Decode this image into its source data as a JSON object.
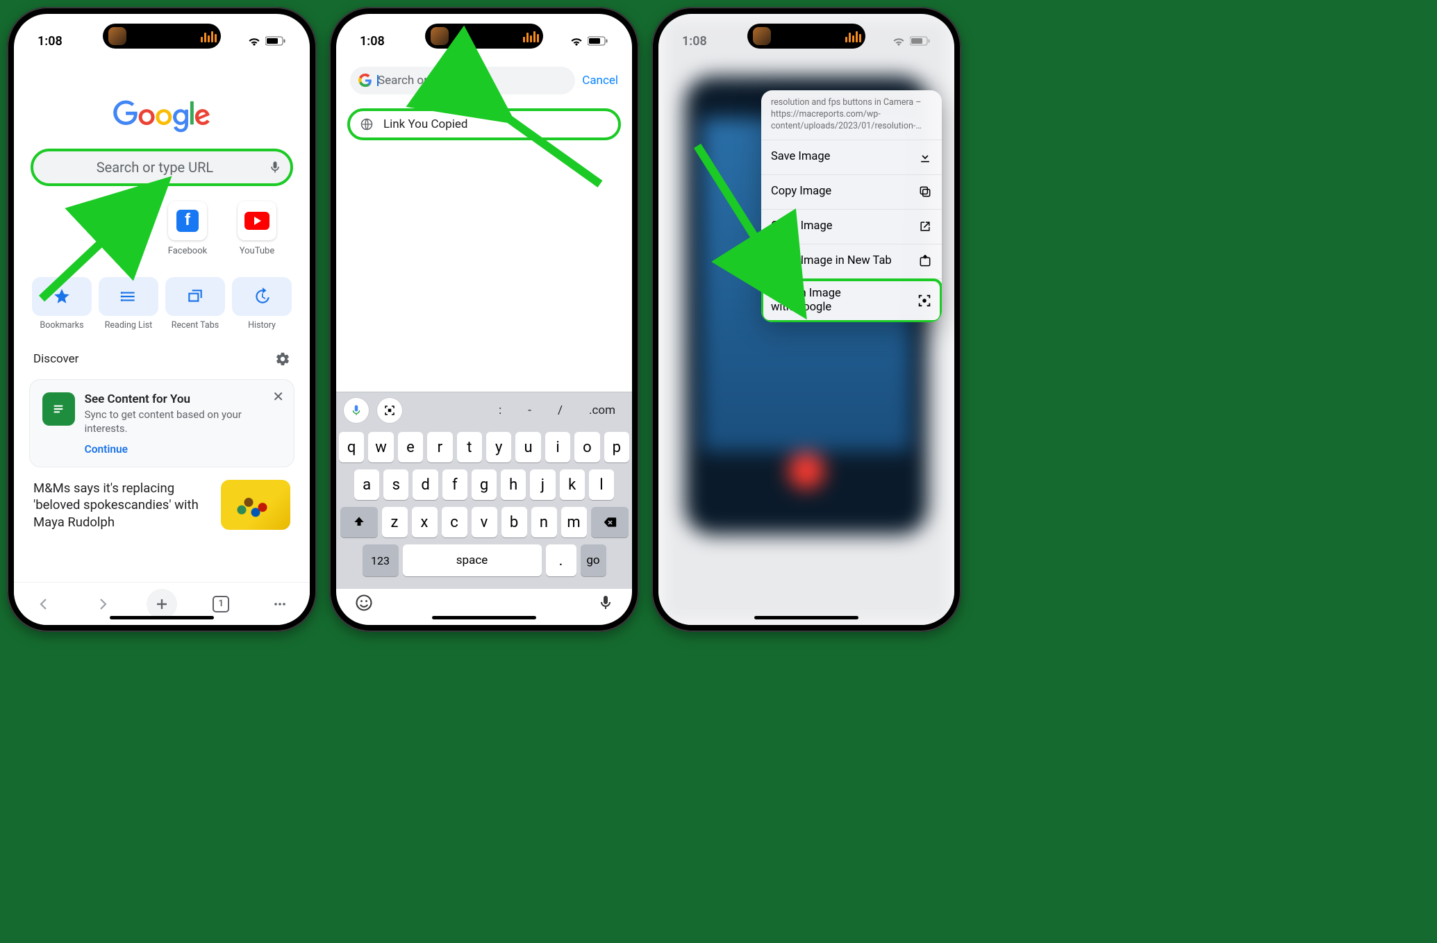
{
  "status": {
    "time": "1:08"
  },
  "screen1": {
    "search_placeholder": "Search or type URL",
    "shortcuts": [
      {
        "label": "Facebook"
      },
      {
        "label": "YouTube"
      }
    ],
    "pills": [
      {
        "label": "Bookmarks"
      },
      {
        "label": "Reading List"
      },
      {
        "label": "Recent Tabs"
      },
      {
        "label": "History"
      }
    ],
    "discover_label": "Discover",
    "card": {
      "title": "See Content for You",
      "subtitle": "Sync to get content based on your interests.",
      "cta": "Continue"
    },
    "news": {
      "headline": "M&Ms says it's replacing 'beloved spokescandies' with Maya Rudolph"
    },
    "toolbar": {
      "tab_count": "1"
    }
  },
  "screen2": {
    "search_placeholder": "Search or type URL",
    "cancel": "Cancel",
    "link_copied": "Link You Copied",
    "suggestions": [
      ":",
      "-",
      "/",
      ".com"
    ],
    "keys_row1": [
      "q",
      "w",
      "e",
      "r",
      "t",
      "y",
      "u",
      "i",
      "o",
      "p"
    ],
    "keys_row2": [
      "a",
      "s",
      "d",
      "f",
      "g",
      "h",
      "j",
      "k",
      "l"
    ],
    "keys_row3": [
      "z",
      "x",
      "c",
      "v",
      "b",
      "n",
      "m"
    ],
    "key_123": "123",
    "key_space": "space",
    "key_dot": ".",
    "key_go": "go"
  },
  "screen3": {
    "menu_header": "resolution and fps buttons in Camera – https://macreports.com/wp-content/uploads/2023/01/resolution-…",
    "items": [
      {
        "label": "Save Image"
      },
      {
        "label": "Copy Image"
      },
      {
        "label": "Open Image"
      },
      {
        "label": "Open Image in New Tab"
      },
      {
        "label": "Search Image\nwith Google"
      }
    ]
  }
}
